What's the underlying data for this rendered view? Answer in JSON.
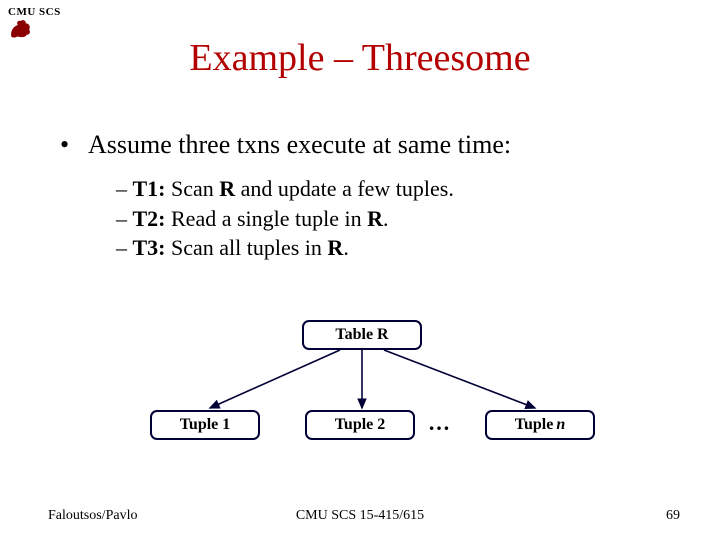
{
  "header": {
    "org": "CMU SCS"
  },
  "title": "Example – Threesome",
  "bullet": "Assume three txns execute at same time:",
  "subs": [
    {
      "label": "T1:",
      "rest": " Scan ",
      "bold2": "R",
      "rest2": " and update a few tuples."
    },
    {
      "label": "T2:",
      "rest": " Read a single tuple in ",
      "bold2": "R",
      "rest2": "."
    },
    {
      "label": "T3:",
      "rest": " Scan all tuples in ",
      "bold2": "R",
      "rest2": "."
    }
  ],
  "diagram": {
    "table": "Table R",
    "tuple1": "Tuple 1",
    "tuple2": "Tuple 2",
    "tuplen_prefix": "Tuple",
    "tuplen_var": "n",
    "dots": "…"
  },
  "footer": {
    "left": "Faloutsos/Pavlo",
    "center": "CMU SCS 15-415/615",
    "right": "69"
  }
}
